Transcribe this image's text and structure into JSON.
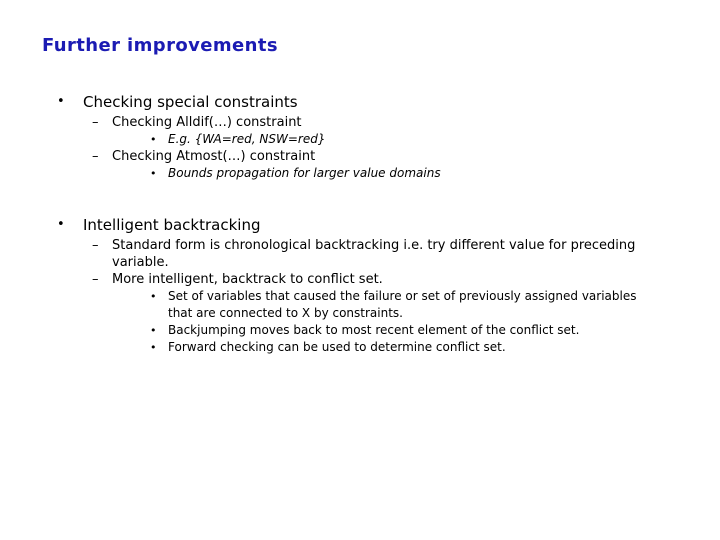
{
  "slide": {
    "title": "Further improvements",
    "title_color": "#1b1bb3",
    "background_color": "#ffffff",
    "bullets": {
      "level1_marker": "•",
      "level2_marker": "–",
      "level3_marker": "•"
    },
    "sections": [
      {
        "heading": "Checking special constraints",
        "sub": [
          {
            "text": "Checking Alldif(…) constraint",
            "sub": [
              {
                "text": "E.g. {WA=red, NSW=red}",
                "italic": true
              }
            ]
          },
          {
            "text": "Checking Atmost(…) constraint",
            "sub": [
              {
                "text": "Bounds propagation for larger value domains",
                "italic": true
              }
            ]
          }
        ]
      },
      {
        "heading": "Intelligent backtracking",
        "sub": [
          {
            "text": "Standard form is chronological backtracking i.e. try different value for preceding variable.",
            "sub": []
          },
          {
            "text": "More intelligent, backtrack to conflict set.",
            "sub": [
              {
                "text": "Set of variables that caused the failure or set of previously assigned variables that are connected to X by constraints.",
                "italic": false
              },
              {
                "text": "Backjumping moves back to most recent element of the conflict set.",
                "italic": false
              },
              {
                "text": "Forward checking can be used to determine conflict set.",
                "italic": false
              }
            ]
          }
        ]
      }
    ]
  }
}
